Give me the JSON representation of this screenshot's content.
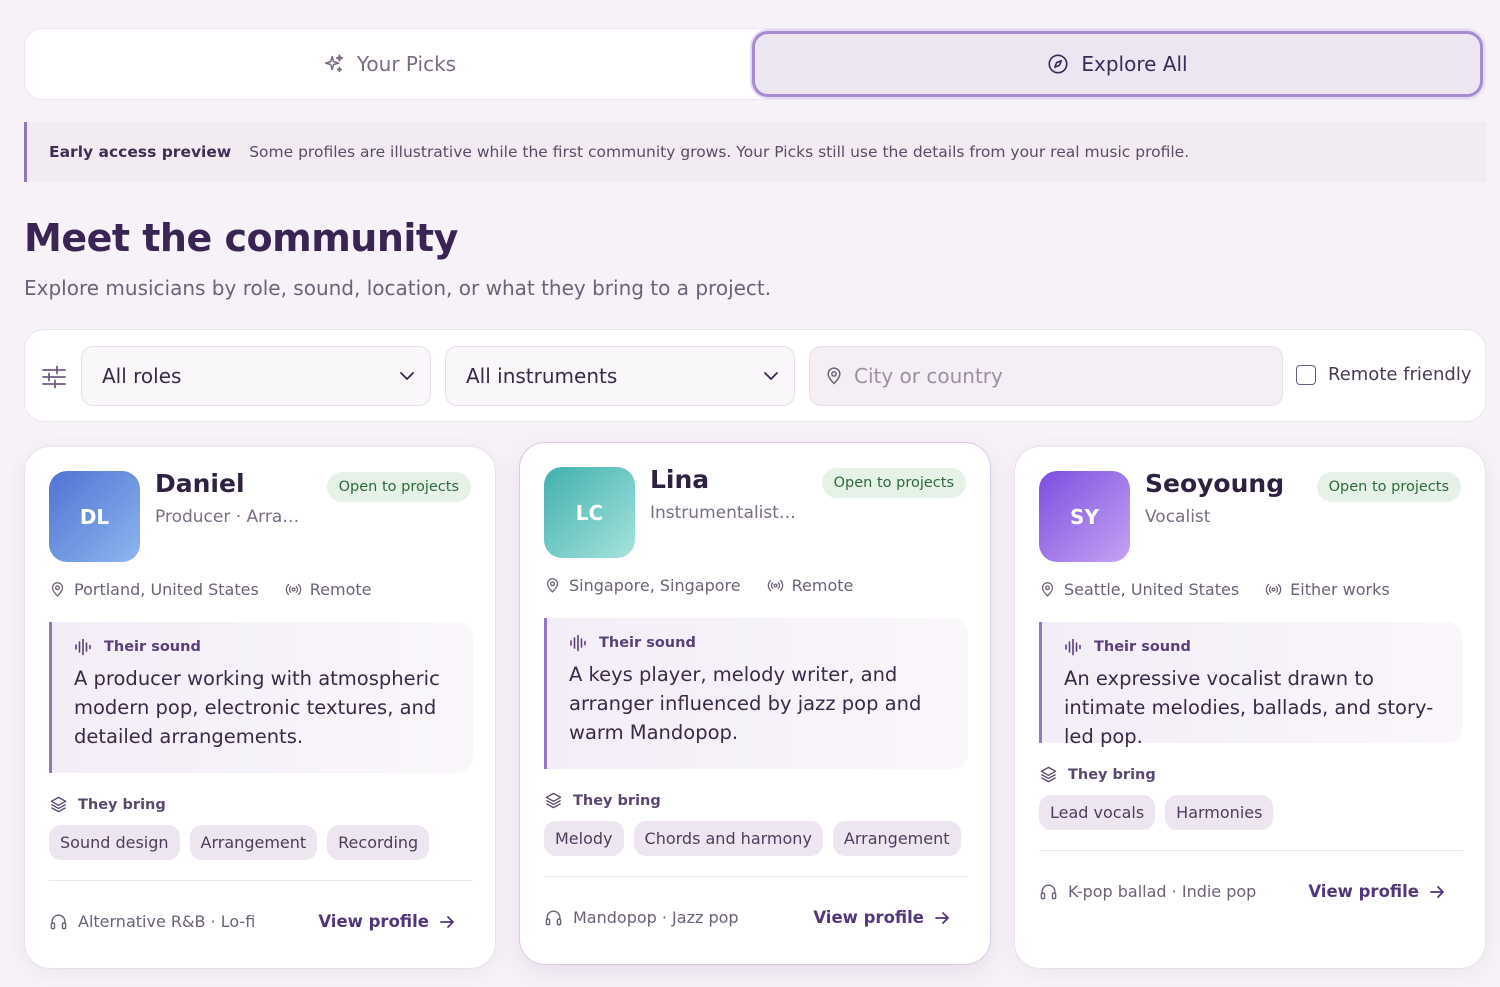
{
  "tabs": [
    {
      "label": "Your Picks",
      "icon": "sparkles-icon",
      "active": false
    },
    {
      "label": "Explore All",
      "icon": "compass-icon",
      "active": true
    }
  ],
  "notice": {
    "title": "Early access preview",
    "text": "Some profiles are illustrative while the first community grows. Your Picks still use the details from your real music profile."
  },
  "page": {
    "title": "Meet the community",
    "subtitle": "Explore musicians by role, sound, location, or what they bring to a project."
  },
  "filters": {
    "role": "All roles",
    "instrument": "All instruments",
    "location_placeholder": "City or country",
    "remote_label": "Remote friendly",
    "remote_checked": false
  },
  "cards": [
    {
      "initials": "DL",
      "name": "Daniel",
      "role": "Producer · Arran...",
      "badge": "Open to projects",
      "location": "Portland, United States",
      "mode": "Remote",
      "sound_label": "Their sound",
      "sound": "A producer working with atmospheric modern pop, electronic textures, and detailed arrangements.",
      "bring_label": "They bring",
      "skills": [
        "Sound design",
        "Arrangement",
        "Recording"
      ],
      "genres": "Alternative R&B · Lo-fi",
      "view_label": "View profile",
      "gradient": [
        "#4e74d3",
        "#8db6ee"
      ]
    },
    {
      "initials": "LC",
      "name": "Lina",
      "role": "Instrumentalist · ...",
      "badge": "Open to projects",
      "location": "Singapore, Singapore",
      "mode": "Remote",
      "sound_label": "Their sound",
      "sound": "A keys player, melody writer, and arranger influenced by jazz pop and warm Mandopop.",
      "bring_label": "They bring",
      "skills": [
        "Melody",
        "Chords and harmony",
        "Arrangement"
      ],
      "genres": "Mandopop · Jazz pop",
      "view_label": "View profile",
      "gradient": [
        "#41b0ad",
        "#a6e3dc"
      ]
    },
    {
      "initials": "SY",
      "name": "Seoyoung",
      "role": "Vocalist",
      "badge": "Open to projects",
      "location": "Seattle, United States",
      "mode": "Either works",
      "sound_label": "Their sound",
      "sound": "An expressive vocalist drawn to intimate melodies, ballads, and story-led pop.",
      "bring_label": "They bring",
      "skills": [
        "Lead vocals",
        "Harmonies"
      ],
      "genres": "K-pop ballad · Indie pop",
      "view_label": "View profile",
      "gradient": [
        "#7b4fe0",
        "#c6a3f3"
      ]
    }
  ]
}
